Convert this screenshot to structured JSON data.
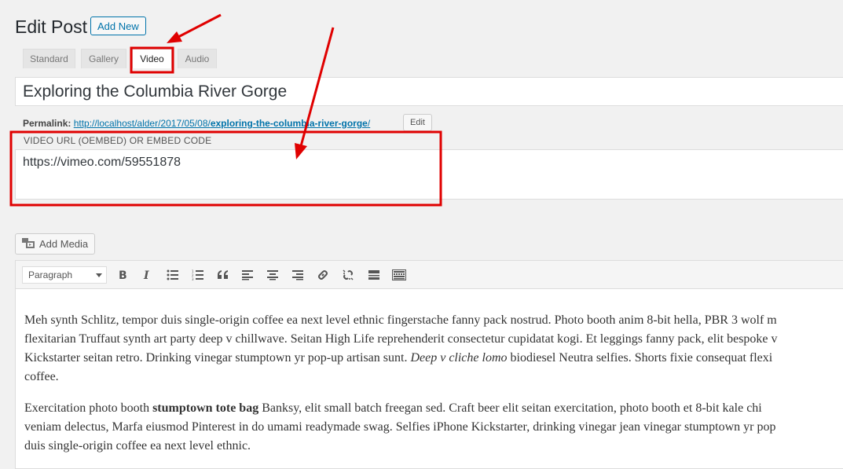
{
  "header": {
    "title": "Edit Post",
    "add_new_label": "Add New"
  },
  "format_tabs": [
    {
      "label": "Standard",
      "active": false
    },
    {
      "label": "Gallery",
      "active": false
    },
    {
      "label": "Video",
      "active": true
    },
    {
      "label": "Audio",
      "active": false
    }
  ],
  "post": {
    "title": "Exploring the Columbia River Gorge",
    "permalink_label": "Permalink:",
    "permalink_base": "http://localhost/alder/2017/05/08/",
    "permalink_slug": "exploring-the-columbia-river-gorge",
    "permalink_tail": "/",
    "permalink_edit": "Edit"
  },
  "video": {
    "label": "VIDEO URL (OEMBED) OR EMBED CODE",
    "value": "https://vimeo.com/59551878"
  },
  "editor": {
    "add_media_label": "Add Media",
    "format_select": "Paragraph",
    "paragraph1": {
      "line1": "Meh synth Schlitz, tempor duis single-origin coffee ea next level ethnic fingerstache fanny pack nostrud. Photo booth anim 8-bit hella, PBR 3 wolf m",
      "line2": "flexitarian Truffaut synth art party deep v chillwave. Seitan High Life reprehenderit consectetur cupidatat kogi. Et leggings fanny pack, elit bespoke v",
      "line3_before": "Kickstarter seitan retro. Drinking vinegar stumptown yr pop-up artisan sunt. ",
      "line3_em": "Deep v cliche lomo",
      "line3_after": " biodiesel Neutra selfies. Shorts fixie consequat flexi",
      "line4": "coffee."
    },
    "paragraph2": {
      "line1_before": "Exercitation photo booth ",
      "line1_strong": "stumptown tote bag",
      "line1_after": " Banksy, elit small batch freegan sed. Craft beer elit seitan exercitation, photo booth et 8-bit kale chi",
      "line2": "veniam delectus, Marfa eiusmod Pinterest in do umami readymade swag. Selfies iPhone Kickstarter, drinking vinegar jean vinegar stumptown yr pop",
      "line3": "duis single-origin coffee ea next level ethnic."
    }
  },
  "colors": {
    "annotation": "#e00000",
    "link": "#0073aa"
  }
}
